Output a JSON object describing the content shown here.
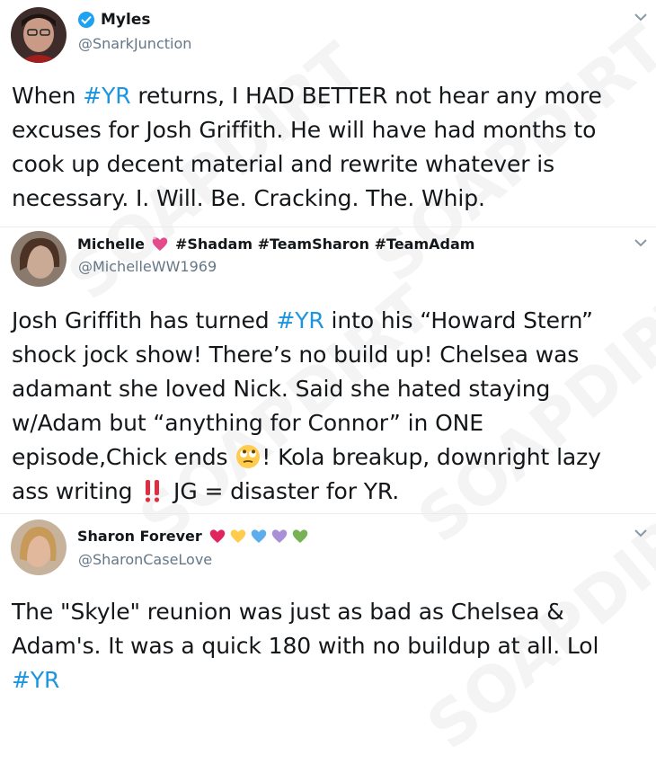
{
  "tweets": [
    {
      "display_name": "Myles",
      "handle": "@SnarkJunction",
      "body_lines": [
        [
          {
            "t": "When "
          },
          {
            "t": "#YR",
            "tag": true
          },
          {
            "t": " returns, I HAD BETTER not hear any more"
          }
        ],
        [
          {
            "t": "excuses for Josh Griffith. He will have had months to"
          }
        ],
        [
          {
            "t": "cook up decent material and rewrite whatever is"
          }
        ],
        [
          {
            "t": "necessary. I. Will. Be. Cracking. The. Whip."
          }
        ]
      ]
    },
    {
      "display_name": "Michelle",
      "display_suffix": "#Shadam #TeamSharon #TeamAdam",
      "handle": "@MichelleWW1969",
      "body_lines": [
        [
          {
            "t": "Josh Griffith has turned "
          },
          {
            "t": "#YR",
            "tag": true
          },
          {
            "t": " into his “Howard Stern”"
          }
        ],
        [
          {
            "t": "shock jock show! There’s no build up! Chelsea was"
          }
        ],
        [
          {
            "t": "adamant she loved Nick. Said she hated staying"
          }
        ],
        [
          {
            "t": "w/Adam but “anything for Connor” in ONE"
          }
        ],
        [
          {
            "t": "episode,Chick ends "
          },
          {
            "emoji": "face-with-rolling-eyes"
          },
          {
            "t": "! Kola breakup, downright lazy"
          }
        ],
        [
          {
            "t": "ass writing "
          },
          {
            "emoji": "double-exclamation"
          },
          {
            "t": " JG = disaster for YR."
          }
        ]
      ]
    },
    {
      "display_name": "Sharon Forever",
      "handle": "@SharonCaseLove",
      "hearts": [
        "#e0245e",
        "#ffcc4d",
        "#5dadec",
        "#aa8ed6",
        "#77b255"
      ],
      "body_lines": [
        [
          {
            "t": "The \"Skyle\" reunion was just as bad as Chelsea &"
          }
        ],
        [
          {
            "t": "Adam's. It was a quick 180 with no buildup at all. Lol"
          }
        ],
        [
          {
            "t": "#YR",
            "tag": true
          }
        ]
      ]
    }
  ],
  "watermark": "SOAPDIRT",
  "colors": {
    "hashtag": "#1b95e0",
    "handle": "#657786",
    "verified_badge": "#1da1f2"
  }
}
